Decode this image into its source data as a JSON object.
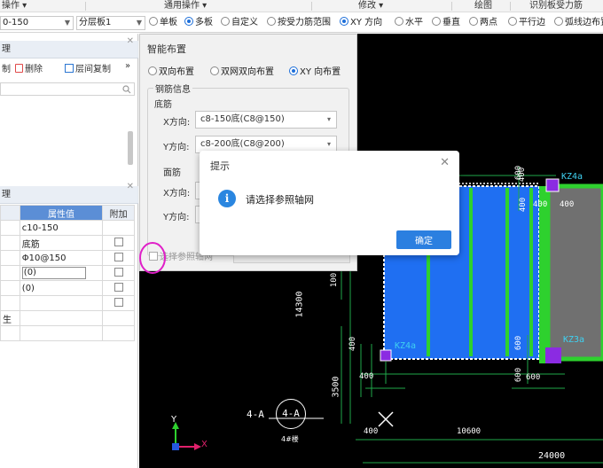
{
  "top_menu": {
    "operation": "操作 ▾",
    "common_ops": "通用操作 ▾",
    "modify": "修改 ▾",
    "draw": "绘图",
    "recognize": "识别板受力筋"
  },
  "option_bar": {
    "rebar_value": "0-150",
    "layer_value": "分层板1",
    "single_board": "单板",
    "multi_board": "多板",
    "custom": "自定义",
    "by_rebar_range": "按受力筋范围",
    "xy_direction": "XY 方向",
    "horizontal": "水平",
    "vertical": "垂直",
    "two_points": "两点",
    "parallel_edge": "平行边",
    "arc_edge": "弧线边布置放"
  },
  "left_panel": {
    "panel1_title": "理",
    "delete_label": "删除",
    "copy_floor_label": "层间复制",
    "more": "»",
    "left_stub": "制",
    "panel2_title": "理",
    "props_header_value": "属性值",
    "props_header_add": "附加",
    "rows": [
      {
        "value": "c10-150",
        "has_check": false
      },
      {
        "value": "底筋",
        "has_check": true
      },
      {
        "value": "Φ10@150",
        "has_check": true
      },
      {
        "value": "(0)",
        "has_check": true
      },
      {
        "value": "(0)",
        "has_check": true
      },
      {
        "value": "",
        "has_check": true
      },
      {
        "value": "",
        "has_check": false
      }
    ],
    "row_stub": "生"
  },
  "smart_panel": {
    "title": "智能布置",
    "mode_bidirectional": "双向布置",
    "mode_double_net": "双网双向布置",
    "mode_xy": "XY 向布置",
    "rebar_info": "钢筋信息",
    "bottom_rebar": "底筋",
    "x_dir_label": "X方向:",
    "x_dir_value": "c8-150底(C8@150)",
    "y_dir_label": "Y方向:",
    "y_dir_value": "c8-200底(C8@200)",
    "top_rebar": "面筋",
    "x_dir_label_2": "X方向:",
    "y_dir_label_2": "Y方向:",
    "select_grid": "选择参照轴网"
  },
  "message_box": {
    "title": "提示",
    "message": "请选择参照轴网",
    "ok_label": "确定"
  },
  "cad": {
    "col_kz4a_top": "KZ4a",
    "col_kz4a_bottom": "KZ4a",
    "col_kz3a": "KZ3a",
    "dim_400_a": "400",
    "dim_400_b": "400",
    "dim_400_c": "400",
    "dim_400_d": "400",
    "dim_400_e": "400",
    "dim_400_f": "400",
    "dim_600_a": "600",
    "dim_600_b": "600",
    "dim_600_c": "600",
    "dim_600_d": "600",
    "dim_14300": "14300",
    "dim_3500": "3500",
    "dim_400_bottom": "400",
    "dim_10600": "10600",
    "dim_24000": "24000",
    "dim_100": "100",
    "axis_label": "4-A",
    "axis_bubble": "4-A",
    "axis_sub": "4#楼",
    "y_axis": "Y",
    "x_axis": "X"
  },
  "colors": {
    "slab_blue": "#1f6ff2",
    "rebar_green": "#2ed12e",
    "column_purple": "#8b2be2",
    "cyan_text": "#3fd0f0",
    "accent": "#1e6fd9"
  }
}
